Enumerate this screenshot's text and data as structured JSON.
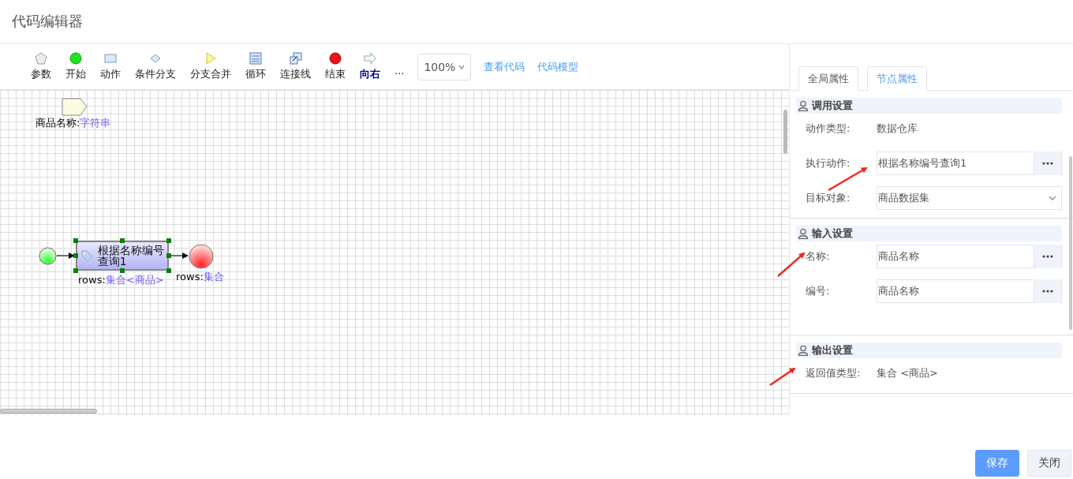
{
  "window": {
    "title": "代码编辑器"
  },
  "toolbar": {
    "items": [
      {
        "kind": "param",
        "label": "参数"
      },
      {
        "kind": "start",
        "label": "开始"
      },
      {
        "kind": "action",
        "label": "动作"
      },
      {
        "kind": "branch",
        "label": "条件分支"
      },
      {
        "kind": "merge",
        "label": "分支合并"
      },
      {
        "kind": "loop",
        "label": "循环"
      },
      {
        "kind": "connector",
        "label": "连接线"
      },
      {
        "kind": "end",
        "label": "结束"
      },
      {
        "kind": "direction",
        "label": "向右"
      },
      {
        "kind": "more",
        "label": "···"
      }
    ],
    "zoom": "100%",
    "links": [
      "查看代码",
      "代码模型"
    ]
  },
  "diagram": {
    "parameter": {
      "name": "商品名称:",
      "type": "字符串"
    },
    "action": {
      "label": "根据名称编号查询1",
      "selected": true,
      "output_name": "rows:",
      "output_type": "集合<商品>"
    },
    "end": {
      "output_name": "rows:",
      "output_type": "集合"
    }
  },
  "panel": {
    "tabs": [
      {
        "label": "全局属性",
        "selected": false
      },
      {
        "label": "节点属性",
        "selected": true
      }
    ],
    "sections": [
      {
        "title": "调用设置",
        "fields": [
          {
            "kind": "text",
            "label": "动作类型:",
            "value": "数据仓库"
          },
          {
            "kind": "picker",
            "label": "执行动作:",
            "value": "根据名称编号查询1"
          },
          {
            "kind": "select",
            "label": "目标对象:",
            "value": "商品数据集"
          }
        ]
      },
      {
        "title": "输入设置",
        "fields": [
          {
            "kind": "picker",
            "label": "名称:",
            "value": "商品名称"
          },
          {
            "kind": "picker",
            "label": "编号:",
            "value": "商品名称"
          }
        ]
      },
      {
        "title": "输出设置",
        "fields": [
          {
            "kind": "text",
            "label": "返回值类型:",
            "value": "集合 <商品>"
          }
        ]
      }
    ]
  },
  "footer": {
    "buttons": [
      {
        "kind": "primary",
        "label": "保存"
      },
      {
        "kind": "default",
        "label": "关闭"
      }
    ]
  }
}
